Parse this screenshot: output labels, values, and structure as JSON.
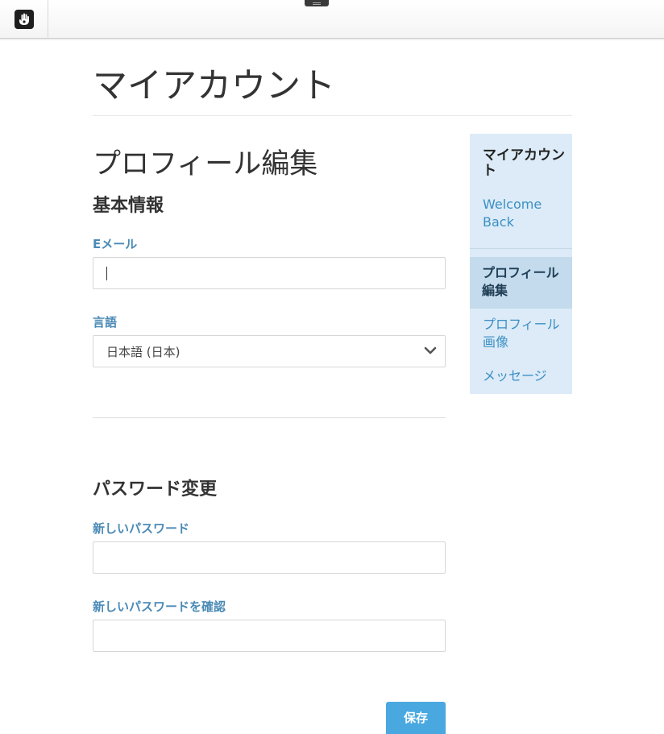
{
  "toolbar": {
    "logo_icon": "concrete5-hand-icon",
    "handle_icon": "panel-handle-icon"
  },
  "page": {
    "title": "マイアカウント"
  },
  "form": {
    "title": "プロフィール編集",
    "basic_heading": "基本情報",
    "email_label": "Eメール",
    "email_value": "",
    "language_label": "言語",
    "language_selected": "日本語 (日本)",
    "password_heading": "パスワード変更",
    "new_password_label": "新しいパスワード",
    "confirm_password_label": "新しいパスワードを確認",
    "save_label": "保存"
  },
  "sidebar": {
    "heading": "マイアカウント",
    "welcome": "Welcome Back",
    "items": [
      {
        "label": "プロフィール編集",
        "active": true
      },
      {
        "label": "プロフィール画像",
        "active": false
      },
      {
        "label": "メッセージ",
        "active": false
      }
    ],
    "accent_color": "#dcebf7"
  },
  "colors": {
    "label": "#4a8ab5",
    "link": "#3b8fc4",
    "button": "#4aa8e0"
  }
}
